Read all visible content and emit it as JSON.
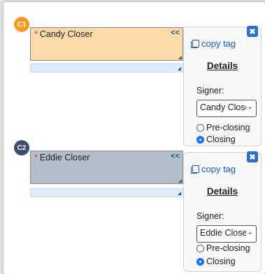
{
  "tags": [
    {
      "badge": "C1",
      "badge_color": "#f59a23",
      "field_bg": "#fbd9a8",
      "field_label": "Candy Closer",
      "required_mark": "*",
      "collapse_label": "<<",
      "panel": {
        "close_label": "✖",
        "copy_tag_label": "copy tag",
        "details_label": "Details",
        "signer_label": "Signer:",
        "signer_value": "Candy Closer",
        "options": [
          {
            "label": "Pre-closing",
            "selected": false
          },
          {
            "label": "Closing",
            "selected": true
          }
        ]
      }
    },
    {
      "badge": "C2",
      "badge_color": "#3b4e6e",
      "field_bg": "#b4bec9",
      "field_label": "Eddie Closer",
      "required_mark": "*",
      "collapse_label": "<<",
      "panel": {
        "close_label": "✖",
        "copy_tag_label": "copy tag",
        "details_label": "Details",
        "signer_label": "Signer:",
        "signer_value": "Eddie Closer",
        "options": [
          {
            "label": "Pre-closing",
            "selected": false
          },
          {
            "label": "Closing",
            "selected": true
          }
        ]
      }
    }
  ]
}
